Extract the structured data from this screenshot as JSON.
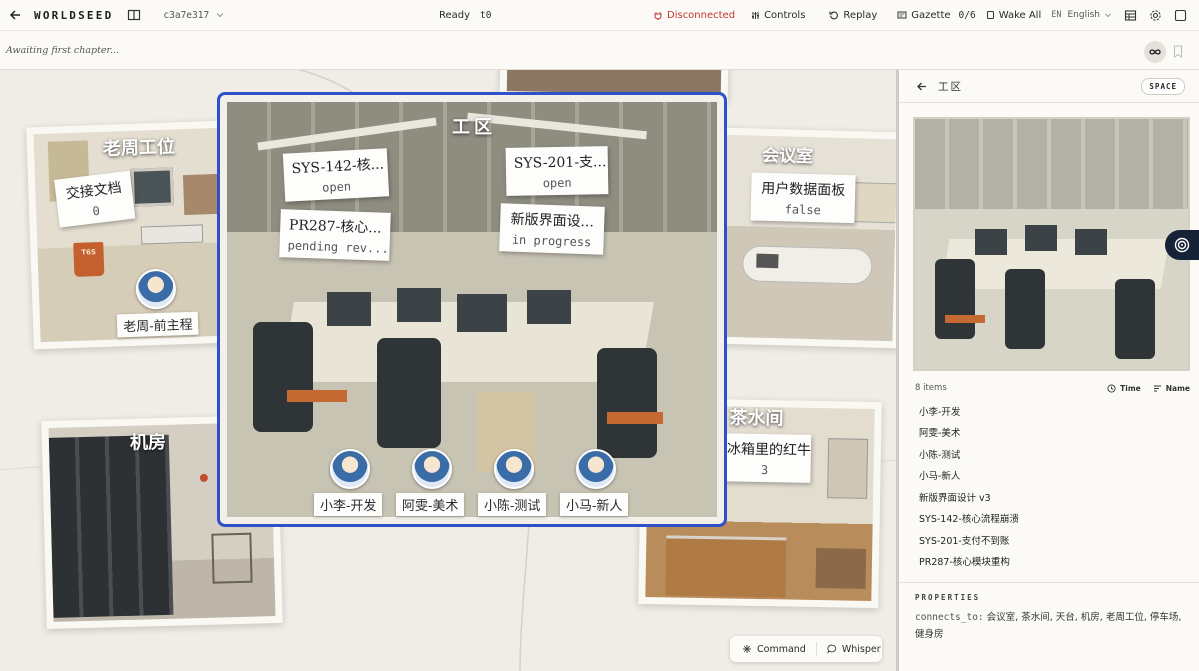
{
  "app": {
    "brand": "WORLDSEED",
    "world_id": "c3a7e317",
    "status": "Ready",
    "tick": "t0"
  },
  "toolbar": {
    "connection": "Disconnected",
    "controls": "Controls",
    "replay": "Replay",
    "gazette": "Gazette",
    "gazette_count": "0/6",
    "wake_all": "Wake All",
    "lang_code": "EN",
    "language": "English",
    "connection_color": "#c3362b"
  },
  "chapter": {
    "text": "Awaiting first chapter..."
  },
  "canvas": {
    "workarea": {
      "title": "工区",
      "notes": [
        {
          "name": "SYS-142-核...",
          "value": "open"
        },
        {
          "name": "SYS-201-支...",
          "value": "open"
        },
        {
          "name": "PR287-核心...",
          "value": "pending rev..."
        },
        {
          "name": "新版界面设...",
          "value": "in progress"
        }
      ],
      "agents": [
        "小李-开发",
        "阿雯-美术",
        "小陈-测试",
        "小马-新人"
      ]
    },
    "old_zhou": {
      "title": "老周工位",
      "note": {
        "name": "交接文档",
        "value": "0"
      },
      "agent": "老周-前主程",
      "mug_text": "T6S"
    },
    "meeting": {
      "title": "会议室",
      "note": {
        "name": "用户数据面板",
        "value": "false"
      }
    },
    "server": {
      "title": "机房"
    },
    "tea": {
      "title": "茶水间",
      "note": {
        "name": "冰箱里的红牛",
        "value": "3"
      }
    }
  },
  "panel": {
    "title": "工区",
    "badge": "SPACE",
    "count": "8 items",
    "sort_time": "Time",
    "sort_name": "Name",
    "items": [
      "小李-开发",
      "阿雯-美术",
      "小陈-测试",
      "小马-新人",
      "新版界面设计 v3",
      "SYS-142-核心流程崩溃",
      "SYS-201-支付不到账",
      "PR287-核心模块重构"
    ],
    "properties_label": "PROPERTIES",
    "prop_key": "connects_to:",
    "prop_value": "会议室, 茶水间, 天台, 机房, 老周工位, 停车场, 健身房"
  },
  "command_bar": {
    "command": "Command",
    "whisper": "Whisper"
  },
  "colors": {
    "accent": "#2f50c9",
    "panel_toggle": "#162238"
  }
}
